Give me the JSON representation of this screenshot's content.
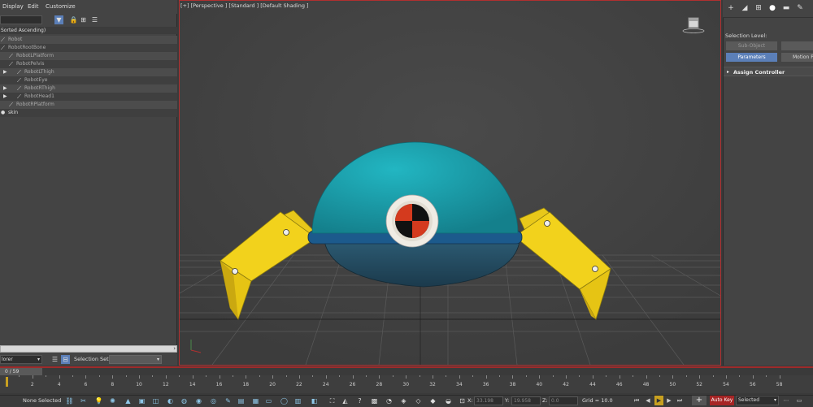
{
  "menu": {
    "display": "Display",
    "edit": "Edit",
    "customize": "Customize"
  },
  "explorer": {
    "sort_header": "Sorted Ascending)",
    "items": [
      {
        "label": "Robot",
        "expandable": false
      },
      {
        "label": "RobotRootBone",
        "expandable": false
      },
      {
        "label": "RobotLPlatform",
        "expandable": false
      },
      {
        "label": "RobotPelvis",
        "expandable": false
      },
      {
        "label": "RobotLThigh",
        "expandable": true
      },
      {
        "label": "RobotEye",
        "expandable": false
      },
      {
        "label": "RobotRThigh",
        "expandable": true
      },
      {
        "label": "RobotHead1",
        "expandable": true
      },
      {
        "label": "RobotRPlatform",
        "expandable": false
      },
      {
        "label": "skin",
        "expandable": false
      }
    ],
    "explorer_dropdown": "lorer",
    "selection_set_label": "Selection Set:"
  },
  "viewport": {
    "label": "[+] [Perspective ] [Standard ] [Default Shading ]"
  },
  "command_panel": {
    "selection_level_label": "Selection Level:",
    "sub_object_button": "Sub-Object",
    "parameters_button": "Parameters",
    "motion_paths_button": "Motion Pa",
    "assign_controller_rollout": "Assign Controller"
  },
  "timeline": {
    "frame_slider": "0 / 59",
    "ticks": [
      "2",
      "4",
      "6",
      "8",
      "10",
      "12",
      "14",
      "16",
      "18",
      "20",
      "22",
      "24",
      "26",
      "28",
      "30",
      "32",
      "34",
      "36",
      "38",
      "40",
      "42",
      "44",
      "46",
      "48",
      "50",
      "52",
      "54",
      "56",
      "58"
    ]
  },
  "status": {
    "selection": "None Selected",
    "x_label": "X:",
    "x_value": "33.198",
    "y_label": "Y:",
    "y_value": "19.958",
    "z_label": "Z:",
    "z_value": "0.0",
    "grid": "Grid = 10.0",
    "auto_key": "Auto Key",
    "selected_dropdown": "Selected"
  },
  "colors": {
    "dome": "#1ba0ad",
    "base": "#22485e",
    "rim": "#1c5a8c",
    "legs": "#f2d21c",
    "viewport_border": "#b03030",
    "accent": "#5b7fb8",
    "auto_key": "#a62525"
  }
}
